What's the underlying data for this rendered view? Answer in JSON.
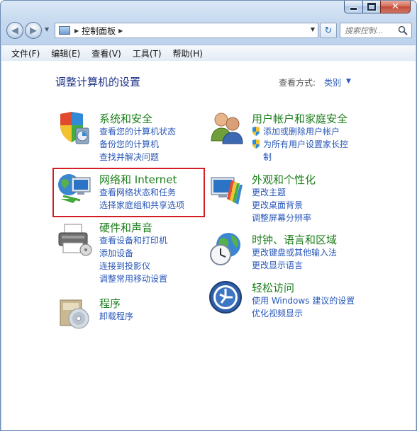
{
  "window": {
    "minimize_label": "",
    "maximize_label": "",
    "close_label": "✕"
  },
  "nav": {
    "back_label": "◀",
    "forward_label": "▶",
    "address": {
      "breadcrumb": "控制面板"
    },
    "search": {
      "placeholder": "搜索控制..."
    }
  },
  "menu": {
    "items": [
      "文件(F)",
      "编辑(E)",
      "查看(V)",
      "工具(T)",
      "帮助(H)"
    ]
  },
  "content": {
    "title": "调整计算机的设置",
    "view_by_label": "查看方式:",
    "view_by_value": "类别"
  },
  "categories": {
    "system_security": {
      "title": "系统和安全",
      "links": [
        "查看您的计算机状态",
        "备份您的计算机",
        "查找并解决问题"
      ]
    },
    "network_internet": {
      "title": "网络和 Internet",
      "links": [
        "查看网络状态和任务",
        "选择家庭组和共享选项"
      ]
    },
    "hardware_sound": {
      "title": "硬件和声音",
      "links": [
        "查看设备和打印机",
        "添加设备",
        "连接到投影仪",
        "调整常用移动设置"
      ]
    },
    "programs": {
      "title": "程序",
      "links": [
        "卸载程序"
      ]
    },
    "user_accounts": {
      "title": "用户帐户和家庭安全",
      "links": [
        "添加或删除用户帐户",
        "为所有用户设置家长控",
        "制"
      ]
    },
    "appearance": {
      "title": "外观和个性化",
      "links": [
        "更改主题",
        "更改桌面背景",
        "调整屏幕分辨率"
      ]
    },
    "clock_region": {
      "title": "时钟、语言和区域",
      "links": [
        "更改键盘或其他输入法",
        "更改显示语言"
      ]
    },
    "ease_of_access": {
      "title": "轻松访问",
      "links": [
        "使用 Windows 建议的设置",
        "优化视频显示"
      ]
    }
  },
  "colors": {
    "category_title": "#1b7e1b",
    "link": "#2957b8",
    "page_title": "#1e3287",
    "highlight_box": "#d41c24"
  }
}
